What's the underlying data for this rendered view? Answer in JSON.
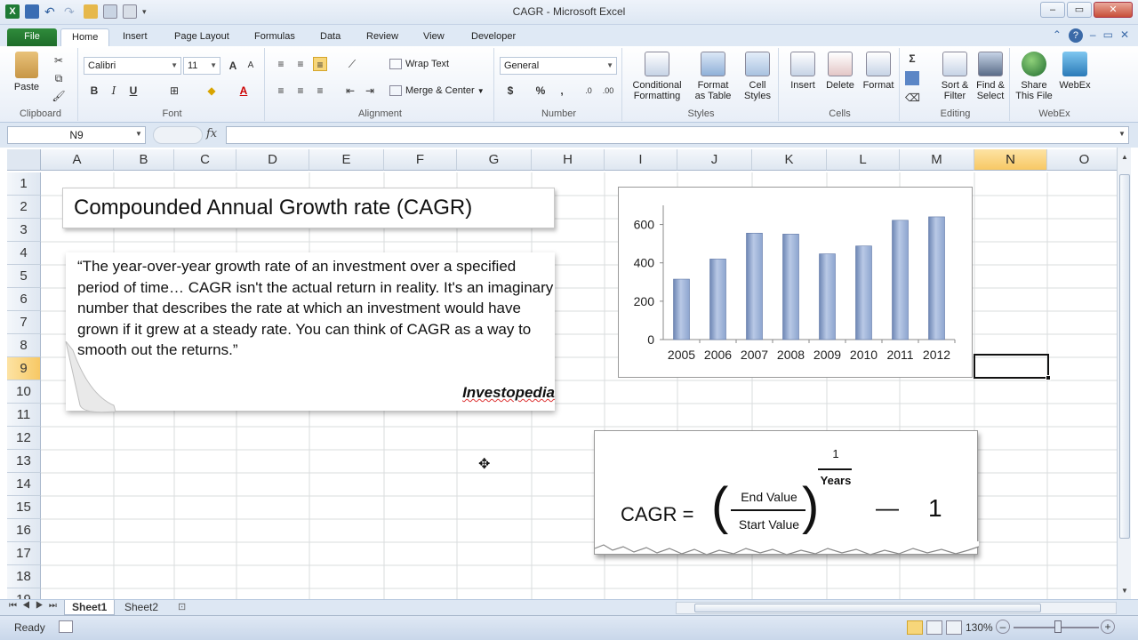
{
  "window": {
    "title": "CAGR  -  Microsoft Excel",
    "buttons": {
      "minimize": "–",
      "restore": "▭",
      "close": "✕"
    }
  },
  "tabs": [
    "File",
    "Home",
    "Insert",
    "Page Layout",
    "Formulas",
    "Data",
    "Review",
    "View",
    "Developer"
  ],
  "ribbon": {
    "clipboard": {
      "paste": "Paste",
      "label": "Clipboard"
    },
    "font": {
      "name": "Calibri",
      "size": "11",
      "label": "Font",
      "bold": "B",
      "italic": "I",
      "underline": "U"
    },
    "alignment": {
      "wrap": "Wrap Text",
      "merge": "Merge & Center",
      "label": "Alignment"
    },
    "number": {
      "format": "General",
      "currency": "$",
      "percent": "%",
      "comma": ",",
      "label": "Number"
    },
    "styles": {
      "conditional_1": "Conditional",
      "conditional_2": "Formatting",
      "format_table_1": "Format",
      "format_table_2": "as Table",
      "cell_styles_1": "Cell",
      "cell_styles_2": "Styles",
      "label": "Styles"
    },
    "cells": {
      "insert": "Insert",
      "delete": "Delete",
      "format": "Format",
      "label": "Cells"
    },
    "editing": {
      "sort_1": "Sort &",
      "sort_2": "Filter",
      "find_1": "Find &",
      "find_2": "Select",
      "sigma": "Σ",
      "label": "Editing"
    },
    "webex": {
      "share_1": "Share",
      "share_2": "This File",
      "webex": "WebEx",
      "label": "WebEx"
    }
  },
  "formula_bar": {
    "name_box": "N9",
    "fx": "fx",
    "value": ""
  },
  "columns": [
    "A",
    "B",
    "C",
    "D",
    "E",
    "F",
    "G",
    "H",
    "I",
    "J",
    "K",
    "L",
    "M",
    "N",
    "O"
  ],
  "selected_column": "N",
  "rows": [
    "1",
    "2",
    "3",
    "4",
    "5",
    "6",
    "7",
    "8",
    "9",
    "10",
    "11",
    "12",
    "13",
    "14",
    "15",
    "16",
    "17",
    "18",
    "19"
  ],
  "selected_row": "9",
  "content": {
    "title": "Compounded Annual Growth rate (CAGR)",
    "quote": "“The year-over-year growth rate of an investment over a specified period of time… CAGR isn't the actual return in reality. It's an imaginary number that describes the rate at which an investment would have grown if it grew at a steady rate. You can think of CAGR as a way to smooth out the returns.”",
    "quote_source": "Investopedia"
  },
  "formula": {
    "lhs": "CAGR =",
    "numerator": "End Value",
    "denominator": "Start Value",
    "exp_numerator": "1",
    "exp_denominator": "Years",
    "minus": "—",
    "one": "1"
  },
  "chart_data": {
    "type": "bar",
    "categories": [
      "2005",
      "2006",
      "2007",
      "2008",
      "2009",
      "2010",
      "2011",
      "2012"
    ],
    "values": [
      315,
      420,
      555,
      550,
      447,
      488,
      622,
      640
    ],
    "yticks": [
      "0",
      "200",
      "400",
      "600"
    ],
    "ylim": [
      0,
      700
    ],
    "title": "",
    "xlabel": "",
    "ylabel": "",
    "bar_color": "#8da5cf",
    "grid": false,
    "legend": "none"
  },
  "sheets": [
    "Sheet1",
    "Sheet2"
  ],
  "active_sheet": "Sheet1",
  "status": {
    "mode": "Ready",
    "zoom": "130%"
  }
}
